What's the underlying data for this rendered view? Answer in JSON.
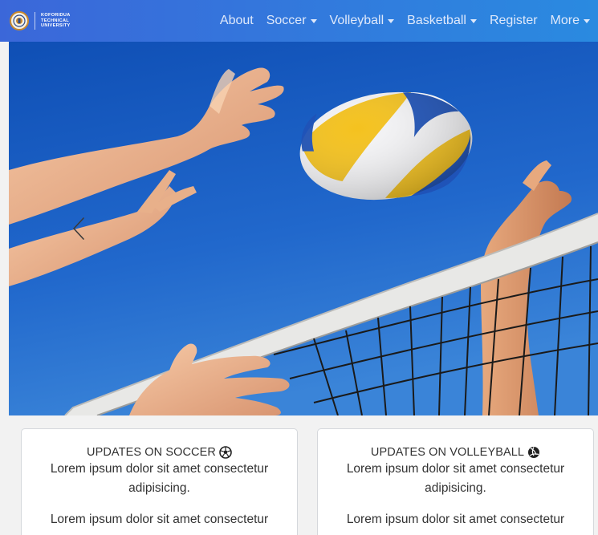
{
  "brand": {
    "lines": [
      "KOFORIDUA",
      "TECHNICAL",
      "UNIVERSITY"
    ],
    "logo_icon": "university-seal-icon"
  },
  "nav": {
    "items": [
      {
        "label": "About",
        "dropdown": false
      },
      {
        "label": "Soccer",
        "dropdown": true
      },
      {
        "label": "Volleyball",
        "dropdown": true
      },
      {
        "label": "Basketball",
        "dropdown": true
      },
      {
        "label": "Register",
        "dropdown": false
      },
      {
        "label": "More",
        "dropdown": true
      }
    ]
  },
  "carousel": {
    "image": "volleyball-at-net-photo",
    "prev_icon": "chevron-left-icon"
  },
  "cards": [
    {
      "title": "UPDATES ON SOCCER",
      "icon": "soccer-ball-icon",
      "text": "Lorem ipsum dolor sit amet consectetur adipisicing.",
      "text2": "Lorem ipsum dolor sit amet consectetur"
    },
    {
      "title": "UPDATES ON VOLLEYBALL",
      "icon": "volleyball-icon",
      "text": "Lorem ipsum dolor sit amet consectetur adipisicing.",
      "text2": "Lorem ipsum dolor sit amet consectetur"
    }
  ],
  "colors": {
    "navbar_start": "#3b67d9",
    "navbar_end": "#2a8ae0",
    "sky": "#1d5fc4",
    "page_bg": "#f2f2f2"
  }
}
